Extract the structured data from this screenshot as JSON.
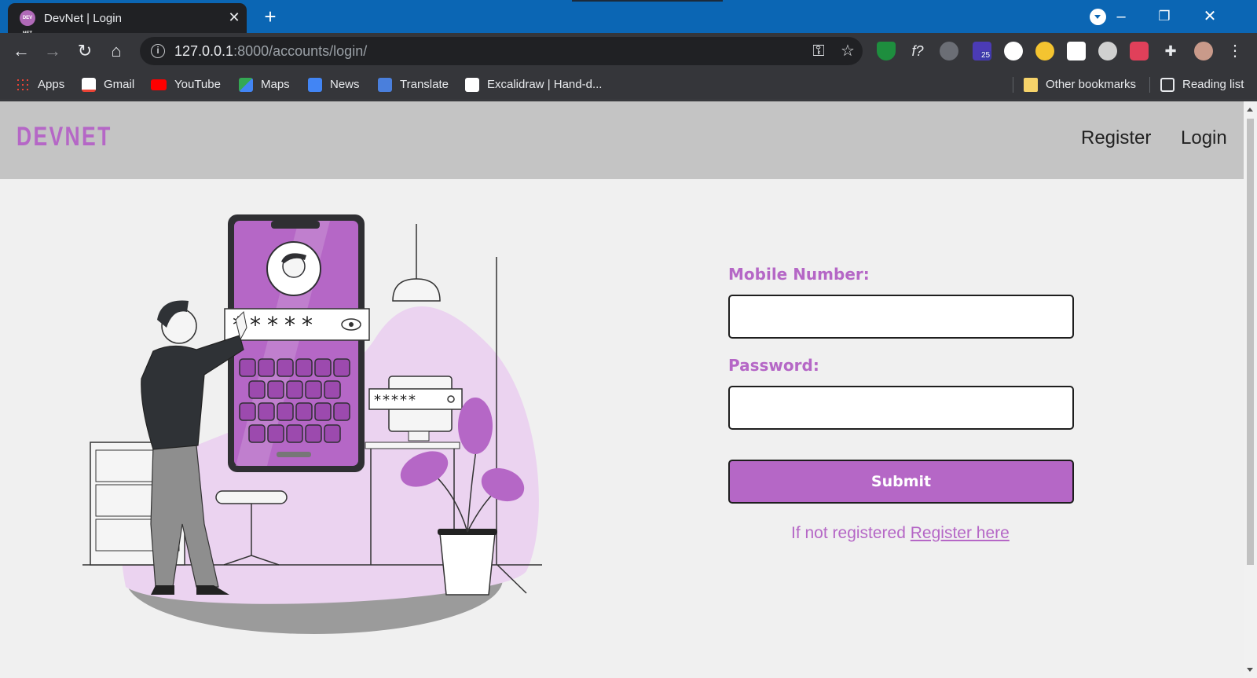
{
  "browser": {
    "tab_title": "DevNet | Login",
    "favicon_text": "DEV NET",
    "url_host": "127.0.0.1",
    "url_rest": ":8000/accounts/login/",
    "extension_badge": "25"
  },
  "bookmarks": {
    "items": [
      "Apps",
      "Gmail",
      "YouTube",
      "Maps",
      "News",
      "Translate",
      "Excalidraw | Hand-d..."
    ],
    "other": "Other bookmarks",
    "reading": "Reading list"
  },
  "page": {
    "brand": "DEVNET",
    "nav": {
      "register": "Register",
      "login": "Login"
    },
    "form": {
      "mobile_label": "Mobile Number:",
      "mobile_value": "",
      "password_label": "Password:",
      "password_value": "",
      "submit": "Submit",
      "register_prompt": "If not registered",
      "register_link": "Register here"
    },
    "illustration": {
      "phone_password": "*****",
      "monitor_password": "*****"
    }
  },
  "colors": {
    "accent": "#b567c6",
    "navbar": "#c4c4c4",
    "page_bg": "#f0f0f0",
    "tabbar": "#0b66b4"
  }
}
